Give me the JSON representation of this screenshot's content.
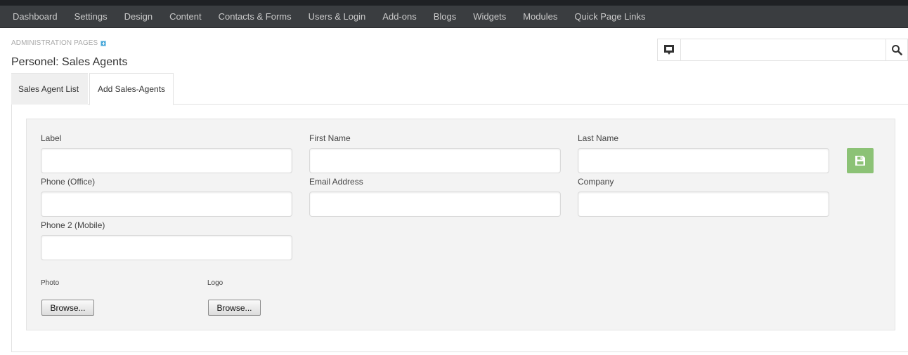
{
  "nav": {
    "items": [
      "Dashboard",
      "Settings",
      "Design",
      "Content",
      "Contacts & Forms",
      "Users & Login",
      "Add-ons",
      "Blogs",
      "Widgets",
      "Modules",
      "Quick Page Links"
    ]
  },
  "breadcrumb": {
    "label": "ADMINISTRATION PAGES"
  },
  "page": {
    "title": "Personel: Sales Agents"
  },
  "search": {
    "value": "",
    "placeholder": ""
  },
  "tabs": [
    {
      "label": "Sales Agent List",
      "active": false
    },
    {
      "label": "Add Sales-Agents",
      "active": true
    }
  ],
  "form": {
    "fields": [
      {
        "label": "Label",
        "value": ""
      },
      {
        "label": "First Name",
        "value": ""
      },
      {
        "label": "Last Name",
        "value": ""
      },
      {
        "label": "Phone (Office)",
        "value": ""
      },
      {
        "label": "Email Address",
        "value": ""
      },
      {
        "label": "Company",
        "value": ""
      },
      {
        "label": "Phone 2 (Mobile)",
        "value": ""
      }
    ],
    "photo_label": "Photo",
    "logo_label": "Logo",
    "browse_label": "Browse..."
  },
  "icons": {
    "flag": "flag-icon",
    "search": "search-icon",
    "save": "save-icon"
  },
  "colors": {
    "nav_bg": "#3a3d40",
    "save_green": "#8cc276"
  }
}
